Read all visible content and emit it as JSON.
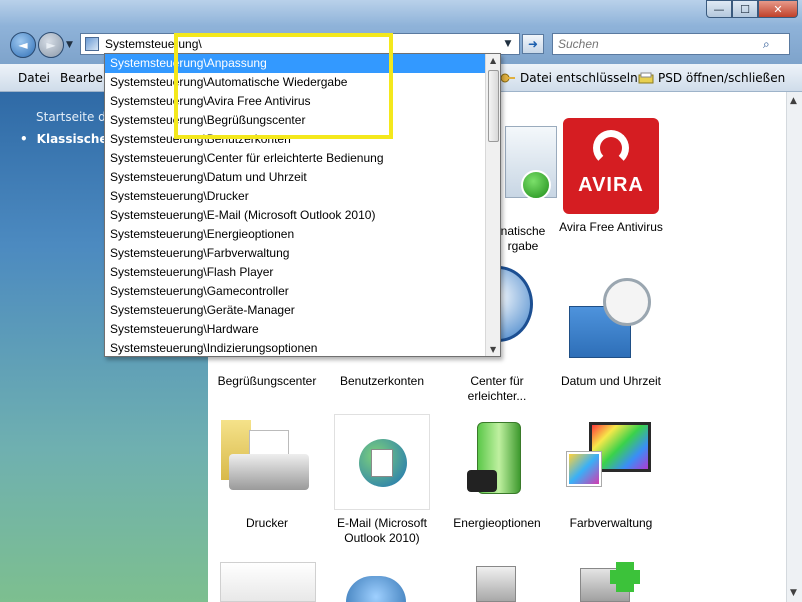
{
  "window": {
    "minimize_glyph": "—",
    "maximize_glyph": "☐",
    "close_glyph": "✕"
  },
  "nav": {
    "back_glyph": "◄",
    "forward_glyph": "►",
    "history_glyph": "▼",
    "address_value": "Systemsteuerung\\",
    "address_dropdown_glyph": "▼",
    "go_glyph": "➜",
    "search_placeholder": "Suchen",
    "search_glyph": "⌕"
  },
  "menubar": {
    "datei": "Datei",
    "bearbeiten": "Bearbeit",
    "cmd_decrypt": "Datei entschlüsseln",
    "cmd_psd": "PSD öffnen/schließen"
  },
  "leftpane": {
    "home": "Startseite der",
    "classic": "Klassische A"
  },
  "items": {
    "autowg_line1": "natische",
    "autowg_line2": "rgabe",
    "avira": "Avira Free Antivirus",
    "avira_logo": "AVIRA",
    "begruessung": "Begrüßungscenter",
    "benutzerkonten": "Benutzerkonten",
    "center_line1": "Center für",
    "center_line2": "erleichter...",
    "datum": "Datum und Uhrzeit",
    "drucker": "Drucker",
    "email_line1": "E-Mail (Microsoft",
    "email_line2": "Outlook 2010)",
    "energie": "Energieoptionen",
    "farb": "Farbverwaltung"
  },
  "dropdown": {
    "items": [
      "Systemsteuerung\\Anpassung",
      "Systemsteuerung\\Automatische Wiedergabe",
      "Systemsteuerung\\Avira Free Antivirus",
      "Systemsteuerung\\Begrüßungscenter",
      "Systemsteuerung\\Benutzerkonten",
      "Systemsteuerung\\Center für erleichterte Bedienung",
      "Systemsteuerung\\Datum und Uhrzeit",
      "Systemsteuerung\\Drucker",
      "Systemsteuerung\\E-Mail (Microsoft Outlook 2010)",
      "Systemsteuerung\\Energieoptionen",
      "Systemsteuerung\\Farbverwaltung",
      "Systemsteuerung\\Flash Player",
      "Systemsteuerung\\Gamecontroller",
      "Systemsteuerung\\Geräte-Manager",
      "Systemsteuerung\\Hardware",
      "Systemsteuerung\\Indizierungsoptionen"
    ],
    "selected_index": 0,
    "scroll_up_glyph": "▲",
    "scroll_down_glyph": "▼"
  },
  "colors": {
    "selection": "#3399ff",
    "highlight_box": "#f4e81c",
    "avira_red": "#d51d22"
  }
}
